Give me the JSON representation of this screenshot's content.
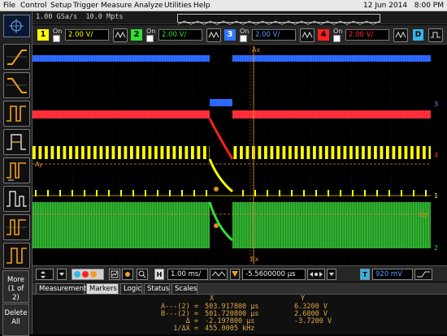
{
  "menu": {
    "items": [
      "File",
      "Control",
      "Setup",
      "Trigger",
      "Measure",
      "Analyze",
      "Utilities",
      "Help"
    ],
    "date": "12 Jun 2014",
    "time": "8:00 PM"
  },
  "acquisition": {
    "sample_rate": "1.00 GSa/s",
    "memory": "10.0 Mpts"
  },
  "channels": [
    {
      "number": "1",
      "on_label": "On",
      "scale": "2.00 V/",
      "color": "#ffff00"
    },
    {
      "number": "2",
      "on_label": "On",
      "scale": "2.00 V/",
      "color": "#33dd33"
    },
    {
      "number": "3",
      "on_label": "On",
      "scale": "2.00 V/",
      "color": "#3377ff"
    },
    {
      "number": "4",
      "on_label": "On",
      "scale": "2.00 V/",
      "color": "#ff2020"
    }
  ],
  "digital_label": "D",
  "side_buttons": {
    "more_label": "More",
    "more_page": "(1 of 2)",
    "delete_label": "Delete",
    "delete_sub": "All"
  },
  "waveform_labels": {
    "cursor_ax_top": "Ax",
    "cursor_ay": "Ay",
    "cursor_bx": "Bx",
    "cursor_by": "By",
    "ch3_marker": "3",
    "ch4_marker": "4",
    "ch1_marker": "1",
    "ch2_marker": "2"
  },
  "controls": {
    "h_label": "H",
    "timebase": "1.00 ms/",
    "delay": "-5.5600000 μs",
    "t_label": "T",
    "trigger_level": "920 mV"
  },
  "tabs": [
    "Measurements",
    "Markers",
    "Logic",
    "Status",
    "Scales"
  ],
  "active_tab": "Markers",
  "markers": {
    "col_x": "X",
    "col_y": "Y",
    "rows": [
      {
        "label": "A---(2) =",
        "x": "503.917800 μs",
        "y": "6.3200 V"
      },
      {
        "label": "B---(2) =",
        "x": "501.720800 μs",
        "y": "2.6800 V"
      },
      {
        "label": "Δ =",
        "x": "-2.197800 μs",
        "y": "-3.7200 V"
      },
      {
        "label": "1/ΔX =",
        "x": "455.0005 kHz",
        "y": ""
      }
    ]
  },
  "colors": {
    "ch1": "#ffff00",
    "ch2": "#33dd33",
    "ch3": "#3377ff",
    "ch4": "#ff2020",
    "marker_text": "#e0a84a",
    "cursor": "#e08a2a"
  }
}
